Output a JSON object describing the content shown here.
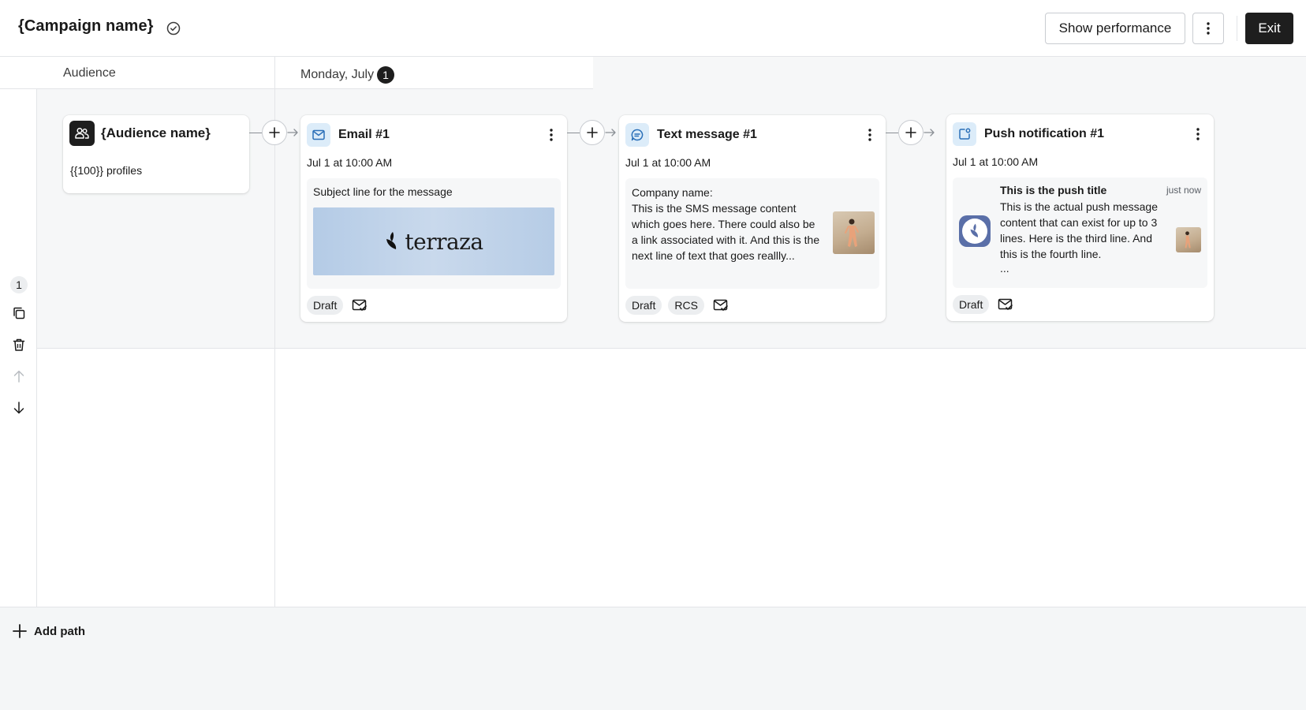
{
  "header": {
    "campaign_name": "{Campaign name}",
    "show_performance_label": "Show performance",
    "exit_label": "Exit"
  },
  "columns": {
    "audience_label": "Audience",
    "date_label": "Monday, July",
    "date_badge": "1"
  },
  "lane": {
    "number": "1"
  },
  "audience_card": {
    "title": "{Audience name}",
    "profiles": "{{100}} profiles"
  },
  "email_card": {
    "title": "Email #1",
    "time": "Jul 1 at 10:00 AM",
    "subject": "Subject line for the message",
    "brand": "terraza",
    "tags": [
      "Draft"
    ]
  },
  "sms_card": {
    "title": "Text message #1",
    "time": "Jul 1 at 10:00 AM",
    "company": "Company name:",
    "body": "This is the SMS message content which goes here. There could also be a link associated with it. And this is the next line of text that goes reallly...",
    "tags": [
      "Draft",
      "RCS"
    ]
  },
  "push_card": {
    "title": "Push notification #1",
    "time": "Jul 1 at 10:00 AM",
    "push_title": "This is the push title",
    "push_time": "just now",
    "push_body": "This is the actual push message content that can exist for up to 3 lines. Here is the third line. And this is the fourth line.",
    "push_ellipsis": "...",
    "tags": [
      "Draft"
    ]
  },
  "footer": {
    "add_path_label": "Add path"
  },
  "colors": {
    "accent_dark": "#1e1e1e",
    "channel_icon_bg": "#dcecf9",
    "channel_icon_fg": "#2a6fb8",
    "canvas_bg": "#f6f7f8"
  }
}
